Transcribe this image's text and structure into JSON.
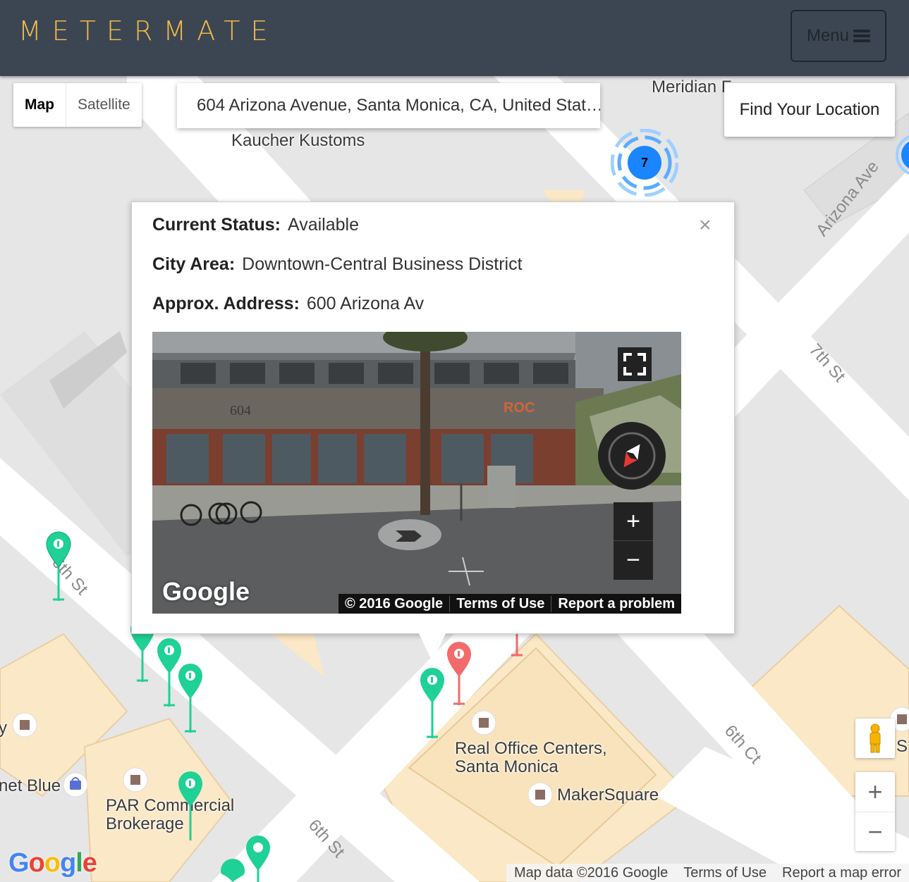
{
  "header": {
    "brand": "METERMATE",
    "menu_label": "Menu"
  },
  "map_controls": {
    "map_type": [
      "Map",
      "Satellite"
    ],
    "search_value": "604 Arizona Avenue, Santa Monica, CA, United Stat…",
    "find_location": "Find Your Location",
    "cluster_count": "7",
    "zoom_in": "+",
    "zoom_out": "−"
  },
  "map_labels": {
    "meridian": "Meridian F",
    "kaucher": "Kaucher Kustoms",
    "real_office": "Real Office Centers,",
    "real_office_2": "Santa Monica",
    "makersquare": "MakerSquare",
    "par": "PAR Commercial",
    "par_2": "Brokerage",
    "net_blue": "net Blue",
    "partial_y": "y",
    "partial_s": "S"
  },
  "streets": {
    "arizona": "Arizona Ave",
    "seventh": "7th St",
    "sixth_left": "6th St",
    "sixth_ct": "6th Ct",
    "sixth_bottom": "6th St"
  },
  "popup": {
    "close": "×",
    "status_label": "Current Status:",
    "status_value": "Available",
    "area_label": "City Area:",
    "area_value": "Downtown-Central Business District",
    "address_label": "Approx. Address:",
    "address_value": "600 Arizona Av"
  },
  "streetview": {
    "logo": "Google",
    "copyright": "© 2016 Google",
    "terms": "Terms of Use",
    "report": "Report a problem",
    "zoom_in": "+",
    "zoom_out": "−",
    "building_number": "604",
    "sign": "ROC"
  },
  "attribution": {
    "logo": "Google",
    "map_data": "Map data ©2016 Google",
    "terms": "Terms of Use",
    "report": "Report a map error"
  },
  "colors": {
    "header_bg": "#3b4652",
    "brand": "#f2b84b",
    "available_meter": "#1fd196",
    "occupied_meter": "#f26a6a",
    "cluster": "#1a85ff"
  }
}
